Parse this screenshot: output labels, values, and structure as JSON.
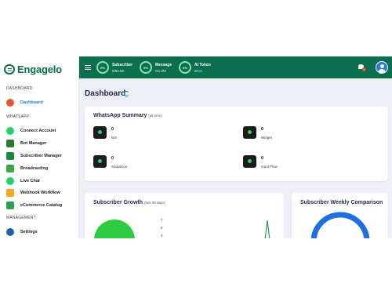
{
  "app": {
    "logo_text": "Engagelo"
  },
  "sidebar": {
    "sections": [
      {
        "label": "DASHBOARD",
        "items": [
          {
            "label": "Dashboard",
            "icon": "dashboard-gauge-icon",
            "active": true,
            "color": "#e8542f"
          }
        ]
      },
      {
        "label": "WHATSAPP",
        "items": [
          {
            "label": "Connect Account",
            "icon": "whatsapp-icon",
            "color": "#25d366"
          },
          {
            "label": "Bot Manager",
            "icon": "bot-icon",
            "color": "#2e7d32"
          },
          {
            "label": "Subscriber Manager",
            "icon": "subscriber-icon",
            "color": "#1b8a3e"
          },
          {
            "label": "Broadcasting",
            "icon": "broadcast-icon",
            "color": "#3aa845"
          },
          {
            "label": "Live Chat",
            "icon": "live-chat-icon",
            "color": "#25d366"
          },
          {
            "label": "Webhook Workflow",
            "icon": "webhook-icon",
            "color": "#f3a623"
          },
          {
            "label": "eCommerce Catalog",
            "icon": "catalog-icon",
            "color": "#2e9e4f"
          }
        ]
      },
      {
        "label": "MANAGEMENT",
        "items": [
          {
            "label": "Settings",
            "icon": "gear-icon",
            "color": "#1f5fa8"
          }
        ]
      }
    ]
  },
  "topbar": {
    "stats": [
      {
        "name": "Subscriber",
        "value": "0/50.0K",
        "percent": "0%"
      },
      {
        "name": "Message",
        "value": "0/1.0M",
        "percent": "0%"
      },
      {
        "name": "AI Token",
        "value": "0/∞∞",
        "percent": "0%"
      }
    ],
    "notification_count": "0"
  },
  "dashboard": {
    "title": "Dashboard",
    "summary": {
      "title": "WhatsApp Summary",
      "subtitle": "(all time)",
      "metrics": [
        {
          "value": "0",
          "label": "Bot",
          "icon": "bot-icon"
        },
        {
          "value": "0",
          "label": "Widget",
          "icon": "link-icon"
        },
        {
          "value": "0",
          "label": "Sequence",
          "icon": "droplet-icon"
        },
        {
          "value": "0",
          "label": "Input Flow",
          "icon": "bar-chart-icon"
        }
      ]
    },
    "growth": {
      "title": "Subscriber Growth",
      "subtitle": "(last 30 days)",
      "y_ticks": [
        "7",
        "6",
        "5"
      ]
    },
    "weekly": {
      "title": "Subscriber Weekly Comparison"
    }
  },
  "colors": {
    "brand": "#0b6e4f",
    "accent": "#1a7bd9",
    "background": "#eef0f8"
  }
}
